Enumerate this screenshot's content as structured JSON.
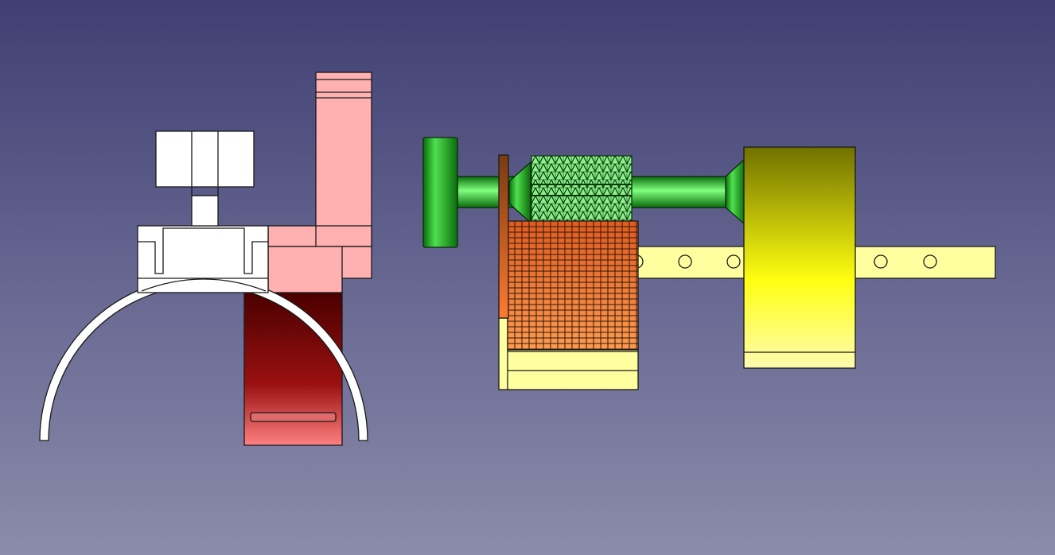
{
  "viewport": {
    "type": "3d-cad-view",
    "background_gradient": [
      "#3f3f73",
      "#8b8bab"
    ]
  },
  "colors": {
    "outline": "#1a1a1a",
    "white_part": "#ffffff",
    "pink_part": "#ffb0b0",
    "dark_red_top": "#4a0000",
    "red_mid": "#9a1010",
    "red_light": "#ff8080",
    "green_dark": "#0b6b0b",
    "green_light": "#7fff7f",
    "green_mesh": "#8cf08c",
    "orange_dark": "#7a3a10",
    "orange": "#ff8040",
    "orange_mesh": "#e85a1a",
    "pale_yellow": "#ffffa0",
    "olive": "#707000",
    "yellow": "#ffff10",
    "yellow_light": "#fffbb0"
  },
  "parts": [
    {
      "name": "t-knob",
      "color_key": "white_part"
    },
    {
      "name": "arc-bracket",
      "color_key": "white_part"
    },
    {
      "name": "clamp-block",
      "color_key": "white_part"
    },
    {
      "name": "pink-bracket",
      "color_key": "pink_part"
    },
    {
      "name": "red-plate",
      "color_key": "red_mid"
    },
    {
      "name": "green-shaft",
      "color_key": "green_dark"
    },
    {
      "name": "gear-mesh",
      "color_key": "green_mesh"
    },
    {
      "name": "orange-mesh-block",
      "color_key": "orange"
    },
    {
      "name": "perforated-rail",
      "color_key": "pale_yellow"
    },
    {
      "name": "yellow-housing",
      "color_key": "yellow"
    }
  ]
}
